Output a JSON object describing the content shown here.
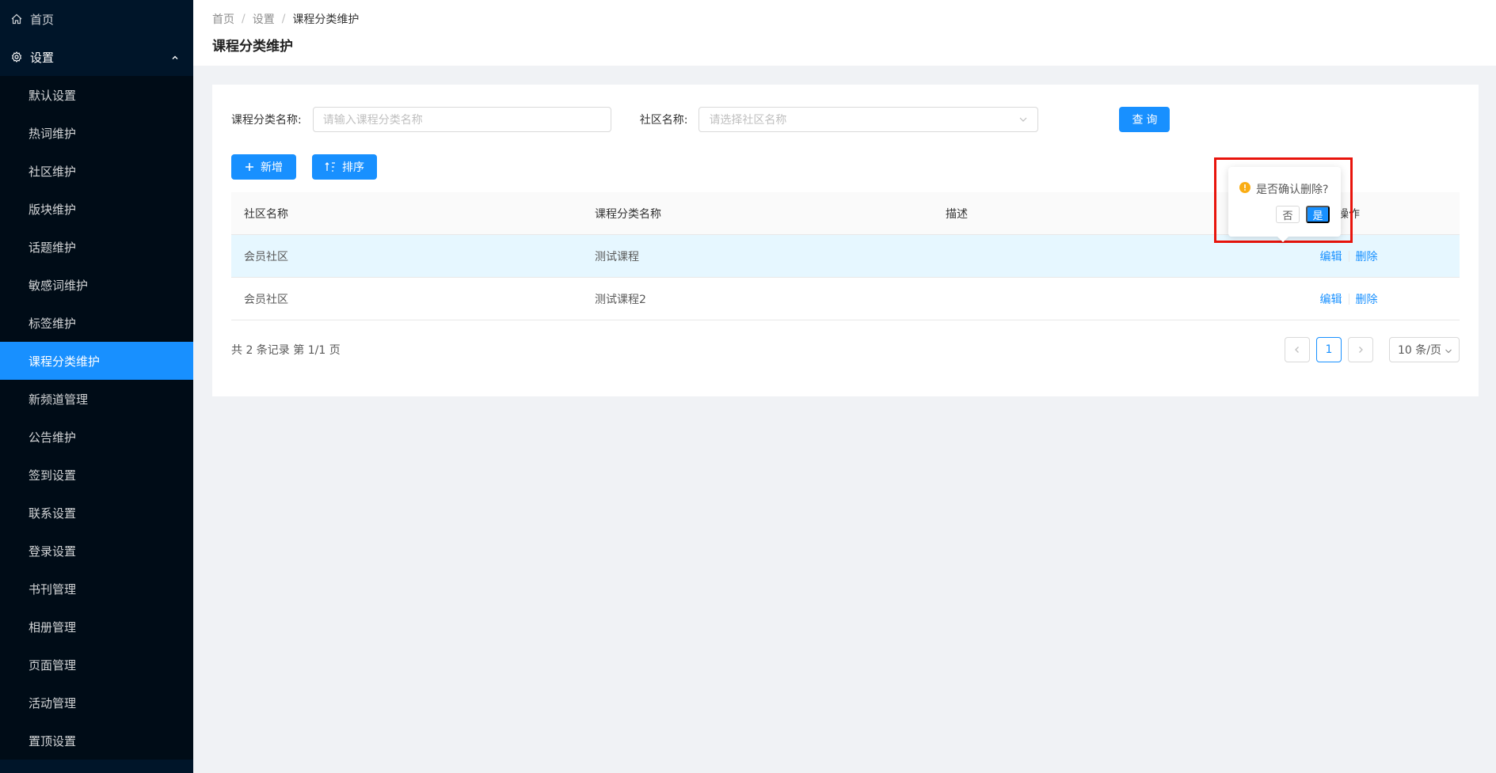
{
  "sidebar": {
    "home": {
      "label": "首页",
      "icon": "home-icon"
    },
    "settings": {
      "label": "设置",
      "icon": "gear-icon",
      "expanded": true
    },
    "items": [
      {
        "label": "默认设置"
      },
      {
        "label": "热词维护"
      },
      {
        "label": "社区维护"
      },
      {
        "label": "版块维护"
      },
      {
        "label": "话题维护"
      },
      {
        "label": "敏感词维护"
      },
      {
        "label": "标签维护"
      },
      {
        "label": "课程分类维护",
        "active": true
      },
      {
        "label": "新频道管理"
      },
      {
        "label": "公告维护"
      },
      {
        "label": "签到设置"
      },
      {
        "label": "联系设置"
      },
      {
        "label": "登录设置"
      },
      {
        "label": "书刊管理"
      },
      {
        "label": "相册管理"
      },
      {
        "label": "页面管理"
      },
      {
        "label": "活动管理"
      },
      {
        "label": "置顶设置"
      }
    ]
  },
  "header": {
    "breadcrumb": [
      "首页",
      "设置",
      "课程分类维护"
    ],
    "title": "课程分类维护"
  },
  "search": {
    "category_label": "课程分类名称:",
    "category_placeholder": "请输入课程分类名称",
    "community_label": "社区名称:",
    "community_placeholder": "请选择社区名称",
    "query_button": "查 询"
  },
  "actions": {
    "add_label": "新增",
    "sort_label": "排序"
  },
  "table": {
    "columns": [
      "社区名称",
      "课程分类名称",
      "描述",
      "操作"
    ],
    "rows": [
      {
        "community": "会员社区",
        "category": "测试课程",
        "description": "",
        "edit": "编辑",
        "delete": "删除"
      },
      {
        "community": "会员社区",
        "category": "测试课程2",
        "description": "",
        "edit": "编辑",
        "delete": "删除"
      }
    ]
  },
  "footer": {
    "total_text": "共 2 条记录 第 1/1 页",
    "current_page": "1",
    "page_size": "10 条/页"
  },
  "popconfirm": {
    "message": "是否确认删除?",
    "cancel": "否",
    "ok": "是"
  },
  "colors": {
    "primary": "#1890ff",
    "sidebar_bg": "#001529",
    "warning": "#faad14",
    "highlight": "#e8140c"
  }
}
